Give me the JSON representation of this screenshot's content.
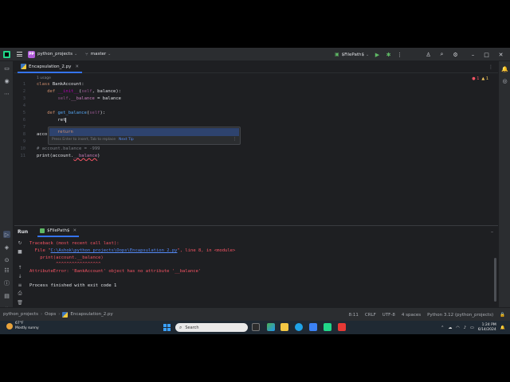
{
  "titlebar": {
    "project_badge": "PP",
    "project_name": "python_projects",
    "branch": "master",
    "run_config": "$FilePath$"
  },
  "editor": {
    "tab_name": "Encapsulation_2.py",
    "usage_hint": "1 usage",
    "inspections": {
      "errors": "1",
      "warnings": "1"
    },
    "line_numbers": [
      "1",
      "2",
      "3",
      "4",
      "5",
      "6",
      "7",
      "8",
      "9",
      "10",
      "11"
    ],
    "lines": {
      "l1": {
        "kw": "class",
        "rest": " BankAccount:"
      },
      "l2": {
        "indent": "    ",
        "kw": "def",
        "sp": " ",
        "fn": "__init__",
        "p1": "(",
        "self": "self",
        "p2": ", balance):"
      },
      "l3": {
        "indent": "        ",
        "self": "self",
        "fld": ".__balance",
        "rest": " = balance"
      },
      "l5": {
        "indent": "    ",
        "kw": "def",
        "sp": " ",
        "fn": "get_balance",
        "p1": "(",
        "self": "self",
        "p2": "):"
      },
      "l6": {
        "indent": "        ",
        "text": "ret"
      },
      "l8": {
        "text": "acco"
      },
      "l10": {
        "comment": "# account.balance = -999"
      },
      "l11": {
        "a": "print(account.",
        "b": "__balance",
        "c": ")"
      }
    },
    "completion": {
      "item": "return",
      "hint": "Press Enter to insert, Tab to replace",
      "link": "Next Tip"
    }
  },
  "run_panel": {
    "title": "Run",
    "tab_name": "$FilePath$",
    "console": {
      "tb": "Traceback (most recent call last):",
      "file_pre": "  File \"",
      "file_path": "C:\\Ashok\\python_projects\\Oops\\Encapsulation_2.py",
      "file_post": "\", line 8, in <module>",
      "code": "    print(account.__balance)",
      "carets": "          ^^^^^^^^^^^^^^^^^",
      "error": "AttributeError: 'BankAccount' object has no attribute '__balance'",
      "exit": "Process finished with exit code 1"
    }
  },
  "statusbar": {
    "crumbs": [
      "python_projects",
      "Oops",
      "Encapsulation_2.py"
    ],
    "position": "8:11",
    "line_sep": "CRLF",
    "encoding": "UTF-8",
    "indent": "4 spaces",
    "interpreter": "Python 3.12 (python_projects)"
  },
  "taskbar": {
    "weather_temp": "67°F",
    "weather_desc": "Mostly sunny",
    "search_placeholder": "Search",
    "time": "1:24 PM",
    "date": "6/14/2024"
  },
  "colors": {
    "editor_bg": "#1e1f22",
    "panel_bg": "#2b2d30",
    "accent": "#3574f0",
    "error": "#f75464",
    "keyword": "#cf8e6d",
    "function": "#56a8f5"
  },
  "icons": {
    "titlebar": [
      "pycharm-logo-icon",
      "hamburger-menu-icon",
      "branch-icon",
      "run-icon",
      "debug-icon",
      "more-icon",
      "add-user-icon",
      "search-icon",
      "settings-icon",
      "minimize-icon",
      "maximize-icon",
      "close-icon"
    ],
    "left_strip": [
      "project-icon",
      "commit-icon",
      "more-tools-icon",
      "structure-icon",
      "run-tool-icon",
      "python-packages-icon",
      "python-console-icon",
      "problems-icon",
      "terminal-icon",
      "git-icon"
    ]
  }
}
